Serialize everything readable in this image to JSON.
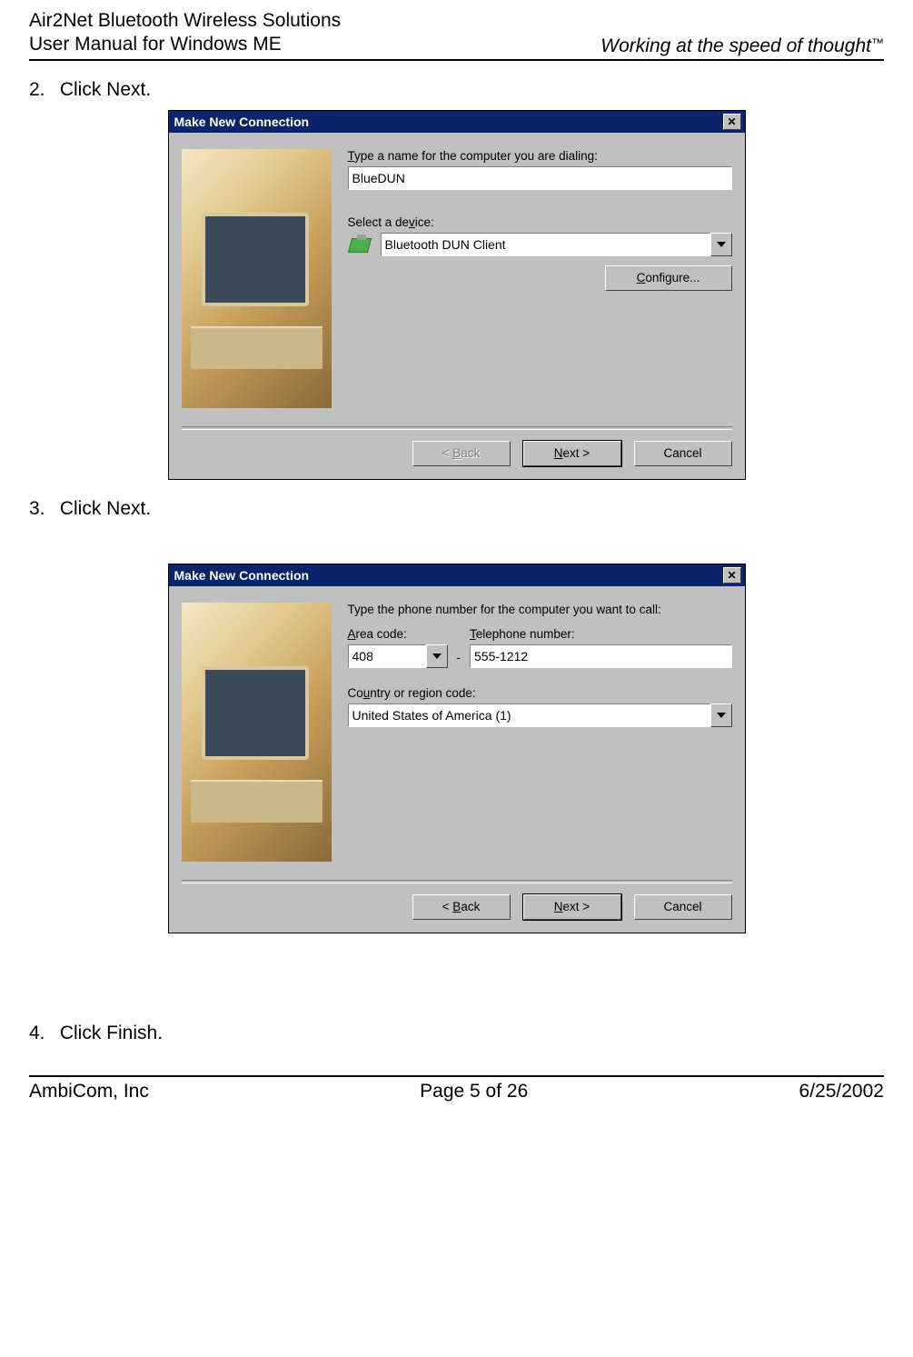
{
  "header": {
    "left_line1": "Air2Net Bluetooth Wireless Solutions",
    "left_line2": "User Manual for Windows ME",
    "right": "Working at the speed of thought",
    "tm": "™"
  },
  "steps": {
    "s2_num": "2.",
    "s2_text": "Click Next.",
    "s3_num": "3.",
    "s3_text": "Click Next.",
    "s4_num": "4.",
    "s4_text": "Click Finish."
  },
  "dialog1": {
    "title": "Make New Connection",
    "label_name_pre": "",
    "label_name_u": "T",
    "label_name_post": "ype a name for the computer you are dialing:",
    "name_value": "BlueDUN",
    "label_device": "Select a de",
    "label_device_u": "v",
    "label_device_post": "ice:",
    "device_value": "Bluetooth DUN Client",
    "configure_u": "C",
    "configure_post": "onfigure...",
    "back_lt": "< ",
    "back_u": "B",
    "back_post": "ack",
    "next_u": "N",
    "next_post": "ext >",
    "cancel": "Cancel"
  },
  "dialog2": {
    "title": "Make New Connection",
    "instruction": "Type the phone number for the computer you want to call:",
    "area_label_u": "A",
    "area_label_post": "rea code:",
    "area_value": "408",
    "dash": "-",
    "tel_label_u": "T",
    "tel_label_post": "elephone number:",
    "tel_value": "555-1212",
    "country_label": "Co",
    "country_label_u": "u",
    "country_label_post": "ntry or region code:",
    "country_value": "United States of America (1)",
    "back_lt": "< ",
    "back_u": "B",
    "back_post": "ack",
    "next_u": "N",
    "next_post": "ext >",
    "cancel": "Cancel"
  },
  "footer": {
    "left": "AmbiCom, Inc",
    "center": "Page 5 of 26",
    "right": "6/25/2002"
  }
}
